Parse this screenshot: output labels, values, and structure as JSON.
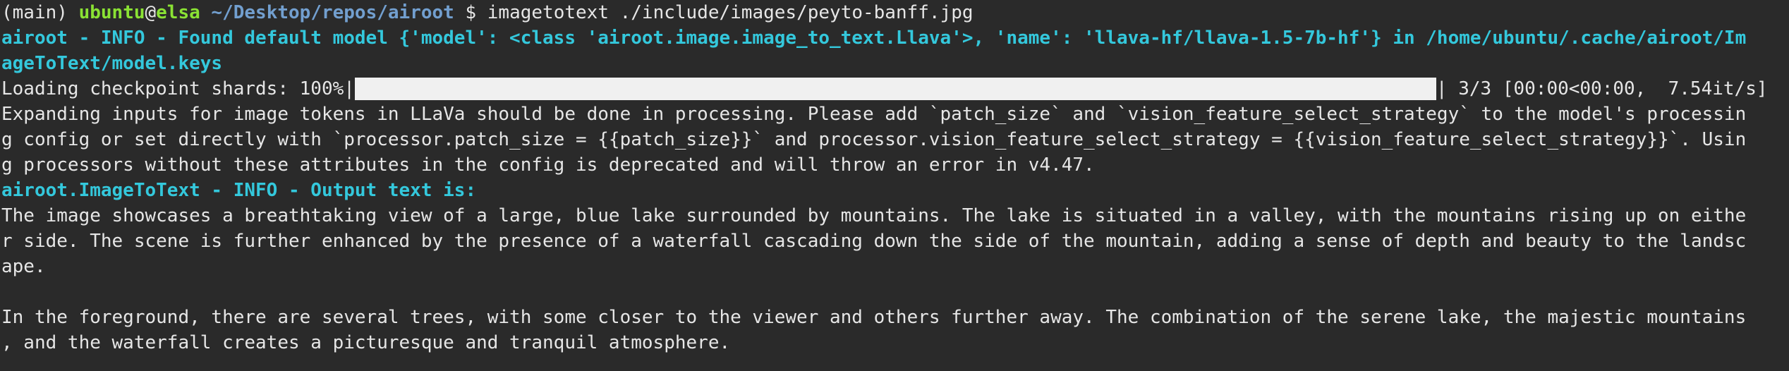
{
  "prompt": {
    "env": "(main) ",
    "user": "ubuntu",
    "at": "@",
    "host": "elsa",
    "path": " ~/Desktop/repos/airoot",
    "symbol": " $ ",
    "command": "imagetotext ./include/images/peyto-banff.jpg"
  },
  "log_info": {
    "line1": "airoot - INFO - Found default model {'model': <class 'airoot.image.image_to_text.Llava'>, 'name': 'llava-hf/llava-1.5-7b-hf'} in /home/ubuntu/.cache/airoot/Im",
    "line2": "ageToText/model.keys"
  },
  "progress": {
    "label": "Loading checkpoint shards: 100%|",
    "fraction": 1.0,
    "suffix": "| 3/3 [00:00<00:00,  7.54it/s]"
  },
  "warning": {
    "line1": "Expanding inputs for image tokens in LLaVa should be done in processing. Please add `patch_size` and `vision_feature_select_strategy` to the model's processin",
    "line2": "g config or set directly with `processor.patch_size = {{patch_size}}` and processor.vision_feature_select_strategy = {{vision_feature_select_strategy}}`. Usin",
    "line3": "g processors without these attributes in the config is deprecated and will throw an error in v4.47."
  },
  "output_header": "airoot.ImageToText - INFO - Output text is:",
  "output": {
    "line1": "The image showcases a breathtaking view of a large, blue lake surrounded by mountains. The lake is situated in a valley, with the mountains rising up on eithe",
    "line2": "r side. The scene is further enhanced by the presence of a waterfall cascading down the side of the mountain, adding a sense of depth and beauty to the landsc",
    "line3": "ape.",
    "line4": "",
    "line5": "In the foreground, there are several trees, with some closer to the viewer and others further away. The combination of the serene lake, the majestic mountains",
    "line6": ", and the waterfall creates a picturesque and tranquil atmosphere."
  },
  "colors": {
    "background": "#2a2a2a",
    "text": "#e6e6e6",
    "prompt_user": "#8ae234",
    "prompt_path": "#729fcf",
    "info": "#34c8dc",
    "progress_fill": "#f0f0f0"
  }
}
